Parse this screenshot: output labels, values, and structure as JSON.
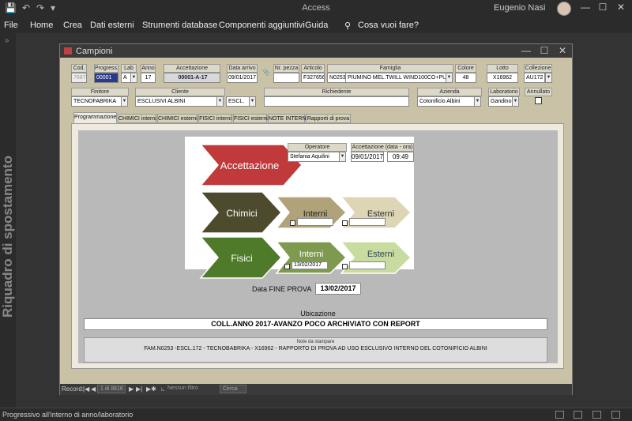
{
  "app": {
    "title": "Access",
    "user": "Eugenio Nasi"
  },
  "menu": [
    "File",
    "Home",
    "Crea",
    "Dati esterni",
    "Strumenti database",
    "Componenti aggiuntivi",
    "Guida",
    "Cosa vuoi fare?"
  ],
  "nav_pane_label": "Riquadro di spostamento",
  "form": {
    "title": "Campioni",
    "header": {
      "cod_label": "Cod.",
      "cod_value": "7867",
      "progress_label": "Progress.",
      "progress_value": "00001",
      "lab_label": "Lab",
      "lab_value": "A",
      "anno_label": "Anno",
      "anno_value": "17",
      "accettazione_label": "Accettazione",
      "accettazione_value": "00001-A-17",
      "data_arrivo_label": "Data arrivo",
      "data_arrivo_value": "09/01/2017",
      "nr_pezza_label": "Nr. pezza",
      "nr_pezza_value": "",
      "articolo_label": "Articolo",
      "articolo_value": "F3276566",
      "famiglia_label": "Famiglia",
      "famiglia_code": "N0253",
      "famiglia_value": "PIUMINO MEL.TWILL WIND100CO+PU",
      "colore_label": "Colore",
      "colore_value": "48",
      "lotto_label": "Lotto",
      "lotto_value": "X16962",
      "collezione_label": "Collezione",
      "collezione_value": "AU172",
      "finitore_label": "Finitore",
      "finitore_value": "TECNOFABRIKA",
      "cliente_label": "Cliente",
      "cliente_value": "ESCLUSIVI ALBINI",
      "cliente_code": "ESCL.",
      "richiedente_label": "Richiedente",
      "richiedente_value": "",
      "azienda_label": "Azienda",
      "azienda_value": "Cotonificio Albini",
      "laboratorio_label": "Laboratorio",
      "laboratorio_value": "Gandino",
      "annullato_label": "Annullato"
    },
    "tabs": [
      "Programmazione",
      "CHIMICI interni",
      "CHIMICI esterni",
      "FISICI interni",
      "FISICI esterni",
      "NOTE INTERNE",
      "Rapporti di prova"
    ],
    "programmazione": {
      "accettazione_label": "Accettazione",
      "operatore_label": "Operatore",
      "operatore_value": "Stefania Aquilini",
      "acc_data_label": "Accettazione (data - ora)",
      "acc_date": "09/01/2017",
      "acc_time": "09:49",
      "chimici_label": "Chimici",
      "chimici_interni_label": "Interni",
      "chimici_esterni_label": "Esterni",
      "fisici_label": "Fisici",
      "fisici_interni_label": "Interni",
      "fisici_interni_date": "13/02/2017",
      "fisici_esterni_label": "Esterni",
      "data_fine_label": "Data FINE PROVA",
      "data_fine_value": "13/02/2017",
      "ubicazione_label": "Ubicazione",
      "ubicazione_value": "COLL.ANNO 2017-AVANZO POCO ARCHIVIATO CON REPORT",
      "note_label": "Note da stampare",
      "note_value": "FAM.N0253 -ESCL.172 - TECNOBABRIKA - X16962 - RAPPORTO DI PROVA AD USO ESCLUSIVO INTERNO DEL COTONIFICIO ALBINI"
    },
    "record_nav": {
      "label": "Record:",
      "position": "1 di 8616",
      "filter": "Nessun filtro",
      "search": "Cerca"
    }
  },
  "status": "Progressivo all'interno di anno/laboratorio",
  "colors": {
    "accettazione": "#c0393b",
    "chimici": "#4d4a2e",
    "chimici_interni": "#b0a37a",
    "chimici_esterni": "#ddd5b5",
    "fisici": "#4f7a2a",
    "fisici_interni": "#7e9a4e",
    "fisici_esterni": "#c8dca0"
  }
}
